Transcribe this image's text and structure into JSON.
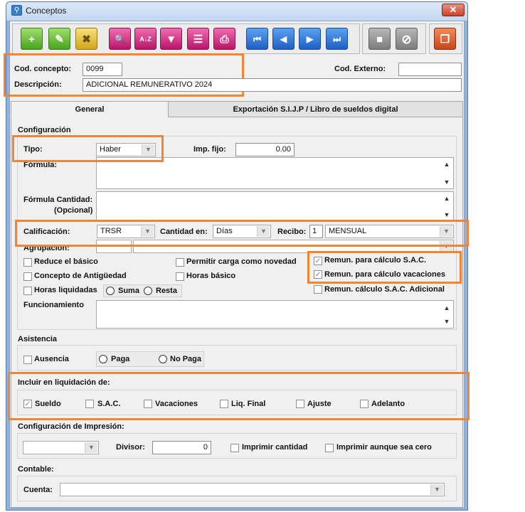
{
  "window": {
    "title": "Conceptos",
    "close": "✕"
  },
  "toolbar": {
    "add": "+",
    "edit": "✎",
    "delete": "✖",
    "search": "🔍",
    "sort": "A↓Z",
    "filter": "▼",
    "report": "☰",
    "print": "⎙",
    "first": "⏮",
    "prev": "◀",
    "next": "▶",
    "last": "⏭",
    "save": "■",
    "cancel": "⊘",
    "copy": "❐"
  },
  "header": {
    "cod_concepto_label": "Cod. concepto:",
    "cod_concepto_value": "0099",
    "cod_externo_label": "Cod. Externo:",
    "cod_externo_value": "",
    "descripcion_label": "Descripción:",
    "descripcion_value": "ADICIONAL REMUNERATIVO 2024"
  },
  "tabs": [
    {
      "label": "General"
    },
    {
      "label": "Exportación S.I.J.P / Libro de sueldos digital"
    }
  ],
  "config": {
    "section": "Configuración",
    "tipo_label": "Tipo:",
    "tipo_value": "Haber",
    "imp_fijo_label": "Imp. fijo:",
    "imp_fijo_value": "0.00",
    "formula_label": "Fórmula:",
    "formula_cant_label": "Fórmula Cantidad:",
    "formula_cant_label2": "(Opcional)",
    "calificacion_label": "Calificación:",
    "calificacion_value": "TRSR",
    "cantidad_en_label": "Cantidad en:",
    "cantidad_en_value": "Días",
    "recibo_label": "Recibo:",
    "recibo_num": "1",
    "recibo_value": "MENSUAL",
    "agrupacion_label": "Agrupación:",
    "reduce_basico": "Reduce el básico",
    "permitir_carga": "Permitir carga como novedad",
    "remun_sac": "Remun. para cálculo S.A.C.",
    "concepto_antig": "Concepto de Antigüedad",
    "horas_basico": "Horas básico",
    "remun_vac": "Remun. para cálculo vacaciones",
    "horas_liq": "Horas liquidadas",
    "suma": "Suma",
    "resta": "Resta",
    "remun_sac_adic": "Remun. cálculo S.A.C. Adicional",
    "funcionamiento_label": "Funcionamiento"
  },
  "asistencia": {
    "section": "Asistencia",
    "ausencia": "Ausencia",
    "paga": "Paga",
    "no_paga": "No Paga"
  },
  "incluir": {
    "section": "Incluir en liquidación de:",
    "sueldo": "Sueldo",
    "sac": "S.A.C.",
    "vacaciones": "Vacaciones",
    "liq_final": "Liq. Final",
    "ajuste": "Ajuste",
    "adelanto": "Adelanto"
  },
  "impresion": {
    "section": "Configuración de Impresión:",
    "divisor_label": "Divisor:",
    "divisor_value": "0",
    "imprimir_cantidad": "Imprimir cantidad",
    "imprimir_cero": "Imprimir aunque sea cero"
  },
  "contable": {
    "section": "Contable:",
    "cuenta_label": "Cuenta:"
  },
  "colors": {
    "highlight": "#f28433",
    "window_border": "#8db2e3"
  }
}
